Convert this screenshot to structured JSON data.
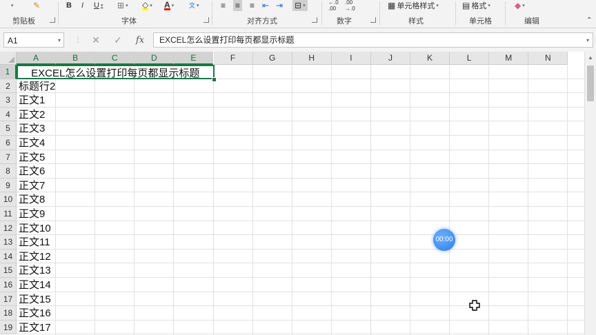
{
  "ribbon": {
    "groups": {
      "clipboard": "剪贴板",
      "font": "字体",
      "alignment": "对齐方式",
      "number": "数字",
      "styles": "样式",
      "cells": "单元格",
      "editing": "编辑"
    },
    "buttons": {
      "bold": "B",
      "italic": "I",
      "underline": "U",
      "cell_styles": "单元格样式",
      "format": "格式"
    }
  },
  "formula_bar": {
    "name_box": "A1",
    "cancel": "✕",
    "enter": "✓",
    "fx": "fx",
    "content": "EXCEL怎么设置打印每页都显示标题"
  },
  "sheet": {
    "columns": [
      "A",
      "B",
      "C",
      "D",
      "E",
      "F",
      "G",
      "H",
      "I",
      "J",
      "K",
      "L",
      "M",
      "N"
    ],
    "rows": [
      "1",
      "2",
      "3",
      "4",
      "5",
      "6",
      "7",
      "8",
      "9",
      "10",
      "11",
      "12",
      "13",
      "14",
      "15",
      "16",
      "17",
      "18",
      "19"
    ],
    "cell_a1": "EXCEL怎么设置打印每页都显示标题",
    "column_a": [
      "标题行2",
      "正文1",
      "正文2",
      "正文3",
      "正文4",
      "正文5",
      "正文6",
      "正文7",
      "正文8",
      "正文9",
      "正文10",
      "正文11",
      "正文12",
      "正文13",
      "正文14",
      "正文15",
      "正文16",
      "正文17"
    ]
  },
  "overlay": {
    "timer": "00:00"
  },
  "colors": {
    "accent": "#217346",
    "timer": "#2b7de9"
  }
}
